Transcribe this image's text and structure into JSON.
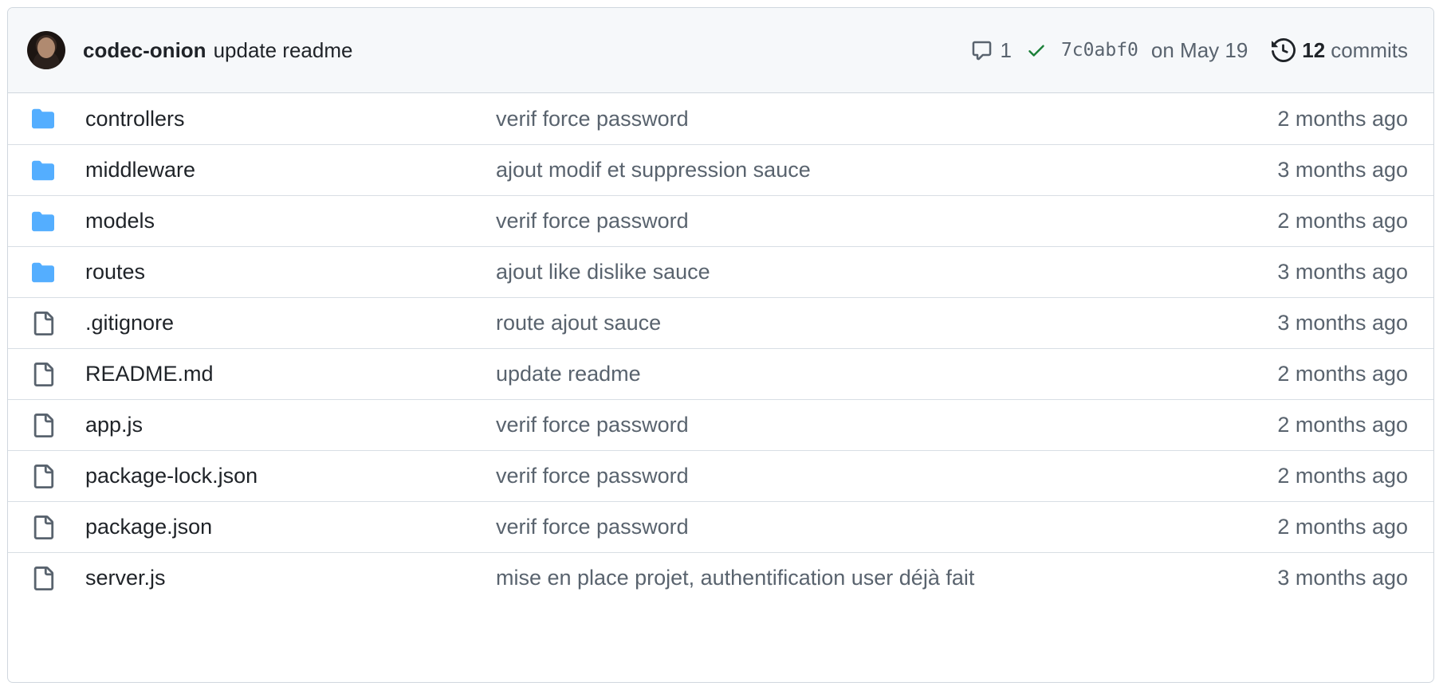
{
  "latest_commit": {
    "author": "codec-onion",
    "message": "update readme",
    "comments": "1",
    "sha": "7c0abf0",
    "date": "on May 19",
    "commits_count": "12",
    "commits_label": "commits"
  },
  "files": [
    {
      "type": "folder",
      "icon": "folder-icon",
      "name": "controllers",
      "message": "verif force password",
      "age": "2 months ago"
    },
    {
      "type": "folder",
      "icon": "folder-icon",
      "name": "middleware",
      "message": "ajout modif et suppression sauce",
      "age": "3 months ago"
    },
    {
      "type": "folder",
      "icon": "folder-icon",
      "name": "models",
      "message": "verif force password",
      "age": "2 months ago"
    },
    {
      "type": "folder",
      "icon": "folder-icon",
      "name": "routes",
      "message": "ajout like dislike sauce",
      "age": "3 months ago"
    },
    {
      "type": "file",
      "icon": "file-icon",
      "name": ".gitignore",
      "message": "route ajout sauce",
      "age": "3 months ago"
    },
    {
      "type": "file",
      "icon": "file-icon",
      "name": "README.md",
      "message": "update readme",
      "age": "2 months ago"
    },
    {
      "type": "file",
      "icon": "file-icon",
      "name": "app.js",
      "message": "verif force password",
      "age": "2 months ago"
    },
    {
      "type": "file",
      "icon": "file-icon",
      "name": "package-lock.json",
      "message": "verif force password",
      "age": "2 months ago"
    },
    {
      "type": "file",
      "icon": "file-icon",
      "name": "package.json",
      "message": "verif force password",
      "age": "2 months ago"
    },
    {
      "type": "file",
      "icon": "file-icon",
      "name": "server.js",
      "message": "mise en place projet, authentification user déjà fait",
      "age": "3 months ago"
    }
  ],
  "colors": {
    "folder": "#54aeff",
    "check": "#1a7f37",
    "header_bg": "#f6f8fa",
    "border": "#d0d7de",
    "muted_text": "#59636e"
  }
}
